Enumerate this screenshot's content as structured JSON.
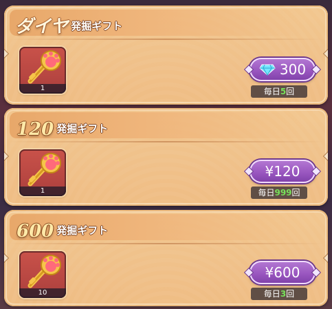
{
  "offers": [
    {
      "title_main": "ダイヤ",
      "title_sub": "発掘ギフト",
      "item": {
        "icon": "paw-key-icon",
        "count": "1"
      },
      "price": {
        "icon": "diamond-icon",
        "label": "300"
      },
      "daily": {
        "prefix": "毎日",
        "value": "5",
        "suffix": "回"
      }
    },
    {
      "title_main": "120",
      "title_sub": "発掘ギフト",
      "item": {
        "icon": "paw-key-icon",
        "count": "1"
      },
      "price": {
        "label": "¥120"
      },
      "daily": {
        "prefix": "毎日",
        "value": "999",
        "suffix": "回"
      }
    },
    {
      "title_main": "600",
      "title_sub": "発掘ギフト",
      "item": {
        "icon": "paw-key-icon",
        "count": "10"
      },
      "price": {
        "label": "¥600"
      },
      "daily": {
        "prefix": "毎日",
        "value": "3",
        "suffix": "回"
      }
    }
  ],
  "colors": {
    "card_bg": "#f0c18a",
    "price_purple": "#9a57c0",
    "daily_count_green": "#77e05a",
    "item_bg_red": "#b84742"
  }
}
